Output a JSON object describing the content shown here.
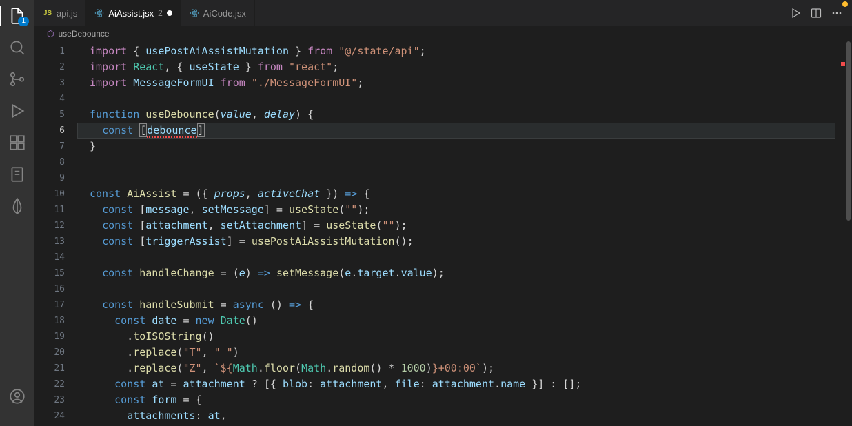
{
  "activity_bar": {
    "explorer_badge": "1"
  },
  "tabs": [
    {
      "icon": "js",
      "label": "api.js",
      "active": false,
      "problems": "",
      "dirty": false
    },
    {
      "icon": "jsx",
      "label": "AiAssist.jsx",
      "active": true,
      "problems": "2",
      "dirty": true
    },
    {
      "icon": "jsx",
      "label": "AiCode.jsx",
      "active": false,
      "problems": "",
      "dirty": false
    }
  ],
  "breadcrumb": {
    "icon": "⬡",
    "label": "useDebounce"
  },
  "current_line": 6,
  "code": [
    {
      "n": 1,
      "tokens": [
        [
          "kw",
          "import"
        ],
        [
          "punct",
          " { "
        ],
        [
          "var",
          "usePostAiAssistMutation"
        ],
        [
          "punct",
          " } "
        ],
        [
          "kw",
          "from"
        ],
        [
          "punct",
          " "
        ],
        [
          "str",
          "\"@/state/api\""
        ],
        [
          "punct",
          ";"
        ]
      ]
    },
    {
      "n": 2,
      "tokens": [
        [
          "kw",
          "import"
        ],
        [
          "punct",
          " "
        ],
        [
          "type",
          "React"
        ],
        [
          "punct",
          ", { "
        ],
        [
          "var",
          "useState"
        ],
        [
          "punct",
          " } "
        ],
        [
          "kw",
          "from"
        ],
        [
          "punct",
          " "
        ],
        [
          "str",
          "\"react\""
        ],
        [
          "punct",
          ";"
        ]
      ]
    },
    {
      "n": 3,
      "tokens": [
        [
          "kw",
          "import"
        ],
        [
          "punct",
          " "
        ],
        [
          "var",
          "MessageFormUI"
        ],
        [
          "punct",
          " "
        ],
        [
          "kw",
          "from"
        ],
        [
          "punct",
          " "
        ],
        [
          "str",
          "\"./MessageFormUI\""
        ],
        [
          "punct",
          ";"
        ]
      ]
    },
    {
      "n": 4,
      "tokens": []
    },
    {
      "n": 5,
      "tokens": [
        [
          "kw2",
          "function"
        ],
        [
          "punct",
          " "
        ],
        [
          "fn",
          "useDebounce"
        ],
        [
          "punct",
          "("
        ],
        [
          "param",
          "value"
        ],
        [
          "punct",
          ", "
        ],
        [
          "param",
          "delay"
        ],
        [
          "punct",
          ") {"
        ]
      ]
    },
    {
      "n": 6,
      "tokens": [
        [
          "punct",
          "  "
        ],
        [
          "kw2",
          "const"
        ],
        [
          "punct",
          " "
        ],
        [
          "bracket-hl",
          "["
        ],
        [
          "err",
          "debounce"
        ],
        [
          "bracket-hl",
          "]"
        ],
        [
          "cursor",
          ""
        ]
      ]
    },
    {
      "n": 7,
      "tokens": [
        [
          "punct",
          "}"
        ]
      ]
    },
    {
      "n": 8,
      "tokens": []
    },
    {
      "n": 9,
      "tokens": []
    },
    {
      "n": 10,
      "tokens": [
        [
          "kw2",
          "const"
        ],
        [
          "punct",
          " "
        ],
        [
          "fn",
          "AiAssist"
        ],
        [
          "punct",
          " = ({ "
        ],
        [
          "param",
          "props"
        ],
        [
          "punct",
          ", "
        ],
        [
          "param",
          "activeChat"
        ],
        [
          "punct",
          " }) "
        ],
        [
          "kw2",
          "=>"
        ],
        [
          "punct",
          " {"
        ]
      ]
    },
    {
      "n": 11,
      "tokens": [
        [
          "punct",
          "  "
        ],
        [
          "kw2",
          "const"
        ],
        [
          "punct",
          " ["
        ],
        [
          "var",
          "message"
        ],
        [
          "punct",
          ", "
        ],
        [
          "var",
          "setMessage"
        ],
        [
          "punct",
          "] = "
        ],
        [
          "fn",
          "useState"
        ],
        [
          "punct",
          "("
        ],
        [
          "str",
          "\"\""
        ],
        [
          "punct",
          ");"
        ]
      ]
    },
    {
      "n": 12,
      "tokens": [
        [
          "punct",
          "  "
        ],
        [
          "kw2",
          "const"
        ],
        [
          "punct",
          " ["
        ],
        [
          "var",
          "attachment"
        ],
        [
          "punct",
          ", "
        ],
        [
          "var",
          "setAttachment"
        ],
        [
          "punct",
          "] = "
        ],
        [
          "fn",
          "useState"
        ],
        [
          "punct",
          "("
        ],
        [
          "str",
          "\"\""
        ],
        [
          "punct",
          ");"
        ]
      ]
    },
    {
      "n": 13,
      "tokens": [
        [
          "punct",
          "  "
        ],
        [
          "kw2",
          "const"
        ],
        [
          "punct",
          " ["
        ],
        [
          "var",
          "triggerAssist"
        ],
        [
          "punct",
          "] = "
        ],
        [
          "fn",
          "usePostAiAssistMutation"
        ],
        [
          "punct",
          "();"
        ]
      ]
    },
    {
      "n": 14,
      "tokens": []
    },
    {
      "n": 15,
      "tokens": [
        [
          "punct",
          "  "
        ],
        [
          "kw2",
          "const"
        ],
        [
          "punct",
          " "
        ],
        [
          "fn",
          "handleChange"
        ],
        [
          "punct",
          " = ("
        ],
        [
          "param",
          "e"
        ],
        [
          "punct",
          ") "
        ],
        [
          "kw2",
          "=>"
        ],
        [
          "punct",
          " "
        ],
        [
          "fn",
          "setMessage"
        ],
        [
          "punct",
          "("
        ],
        [
          "var",
          "e"
        ],
        [
          "punct",
          "."
        ],
        [
          "var",
          "target"
        ],
        [
          "punct",
          "."
        ],
        [
          "var",
          "value"
        ],
        [
          "punct",
          ");"
        ]
      ]
    },
    {
      "n": 16,
      "tokens": []
    },
    {
      "n": 17,
      "tokens": [
        [
          "punct",
          "  "
        ],
        [
          "kw2",
          "const"
        ],
        [
          "punct",
          " "
        ],
        [
          "fn",
          "handleSubmit"
        ],
        [
          "punct",
          " = "
        ],
        [
          "kw2",
          "async"
        ],
        [
          "punct",
          " () "
        ],
        [
          "kw2",
          "=>"
        ],
        [
          "punct",
          " {"
        ]
      ]
    },
    {
      "n": 18,
      "tokens": [
        [
          "punct",
          "    "
        ],
        [
          "kw2",
          "const"
        ],
        [
          "punct",
          " "
        ],
        [
          "var",
          "date"
        ],
        [
          "punct",
          " = "
        ],
        [
          "kw2",
          "new"
        ],
        [
          "punct",
          " "
        ],
        [
          "type",
          "Date"
        ],
        [
          "punct",
          "()"
        ]
      ]
    },
    {
      "n": 19,
      "tokens": [
        [
          "punct",
          "      ."
        ],
        [
          "fn",
          "toISOString"
        ],
        [
          "punct",
          "()"
        ]
      ]
    },
    {
      "n": 20,
      "tokens": [
        [
          "punct",
          "      ."
        ],
        [
          "fn",
          "replace"
        ],
        [
          "punct",
          "("
        ],
        [
          "str",
          "\"T\""
        ],
        [
          "punct",
          ", "
        ],
        [
          "str",
          "\" \""
        ],
        [
          "punct",
          ")"
        ]
      ]
    },
    {
      "n": 21,
      "tokens": [
        [
          "punct",
          "      ."
        ],
        [
          "fn",
          "replace"
        ],
        [
          "punct",
          "("
        ],
        [
          "str",
          "\"Z\""
        ],
        [
          "punct",
          ", "
        ],
        [
          "str",
          "`${"
        ],
        [
          "type",
          "Math"
        ],
        [
          "punct",
          "."
        ],
        [
          "fn",
          "floor"
        ],
        [
          "punct",
          "("
        ],
        [
          "type",
          "Math"
        ],
        [
          "punct",
          "."
        ],
        [
          "fn",
          "random"
        ],
        [
          "punct",
          "() * "
        ],
        [
          "num",
          "1000"
        ],
        [
          "punct",
          ")"
        ],
        [
          "str",
          "}+00:00`"
        ],
        [
          "punct",
          ");"
        ]
      ]
    },
    {
      "n": 22,
      "tokens": [
        [
          "punct",
          "    "
        ],
        [
          "kw2",
          "const"
        ],
        [
          "punct",
          " "
        ],
        [
          "var",
          "at"
        ],
        [
          "punct",
          " = "
        ],
        [
          "var",
          "attachment"
        ],
        [
          "punct",
          " ? [{ "
        ],
        [
          "var",
          "blob"
        ],
        [
          "punct",
          ": "
        ],
        [
          "var",
          "attachment"
        ],
        [
          "punct",
          ", "
        ],
        [
          "var",
          "file"
        ],
        [
          "punct",
          ": "
        ],
        [
          "var",
          "attachment"
        ],
        [
          "punct",
          "."
        ],
        [
          "var",
          "name"
        ],
        [
          "punct",
          " }] : [];"
        ]
      ]
    },
    {
      "n": 23,
      "tokens": [
        [
          "punct",
          "    "
        ],
        [
          "kw2",
          "const"
        ],
        [
          "punct",
          " "
        ],
        [
          "var",
          "form"
        ],
        [
          "punct",
          " = {"
        ]
      ]
    },
    {
      "n": 24,
      "tokens": [
        [
          "punct",
          "      "
        ],
        [
          "var",
          "attachments"
        ],
        [
          "punct",
          ": "
        ],
        [
          "var",
          "at"
        ],
        [
          "punct",
          ","
        ]
      ]
    }
  ]
}
